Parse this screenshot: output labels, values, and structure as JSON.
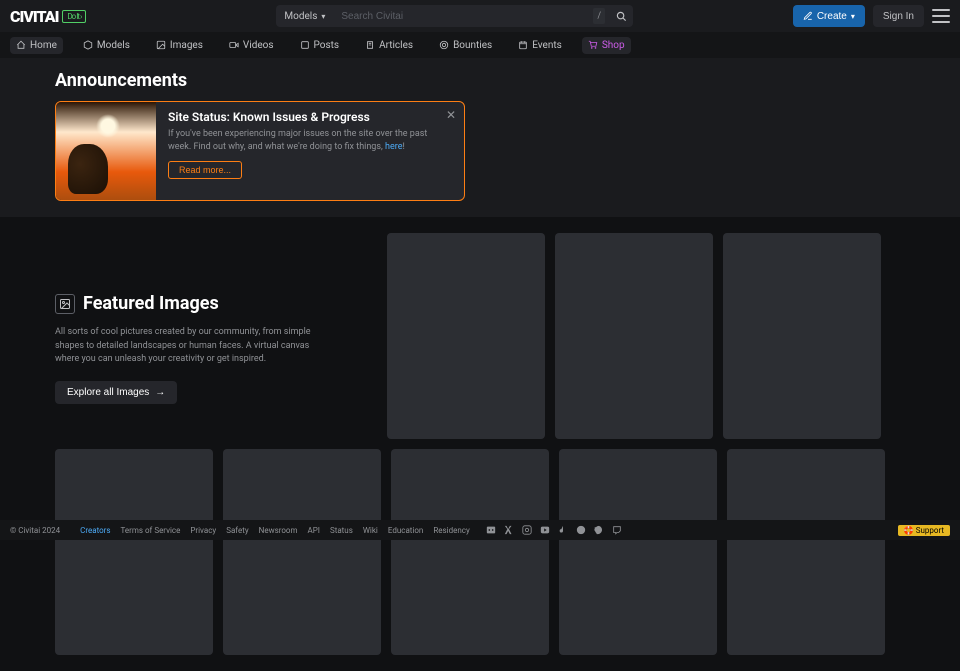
{
  "header": {
    "logo_text": "CIVITAI",
    "logo_badge": "Do It ›",
    "search_dropdown": "Models",
    "search_placeholder": "Search Civitai",
    "search_shortcut": "/",
    "create_label": "Create",
    "signin_label": "Sign In"
  },
  "nav": [
    {
      "icon": "home-icon",
      "label": "Home",
      "active": true
    },
    {
      "icon": "cube-icon",
      "label": "Models"
    },
    {
      "icon": "image-icon",
      "label": "Images"
    },
    {
      "icon": "video-icon",
      "label": "Videos"
    },
    {
      "icon": "post-icon",
      "label": "Posts"
    },
    {
      "icon": "article-icon",
      "label": "Articles"
    },
    {
      "icon": "bounty-icon",
      "label": "Bounties"
    },
    {
      "icon": "event-icon",
      "label": "Events"
    },
    {
      "icon": "shop-icon",
      "label": "Shop",
      "shop": true
    }
  ],
  "announcements": {
    "heading": "Announcements",
    "card": {
      "title": "Site Status: Known Issues & Progress",
      "text_1": "If you've been experiencing major issues on the site over the past week. Find out why, and what we're doing to fix things, ",
      "link_text": "here",
      "read_more": "Read more..."
    }
  },
  "featured": {
    "title": "Featured Images",
    "desc": "All sorts of cool pictures created by our community, from simple shapes to detailed landscapes or human faces. A virtual canvas where you can unleash your creativity or get inspired.",
    "explore": "Explore all Images"
  },
  "footer": {
    "copyright": "© Civitai 2024",
    "links": [
      "Creators",
      "Terms of Service",
      "Privacy",
      "Safety",
      "Newsroom",
      "API",
      "Status",
      "Wiki",
      "Education",
      "Residency"
    ],
    "support": "🛟 Support"
  }
}
